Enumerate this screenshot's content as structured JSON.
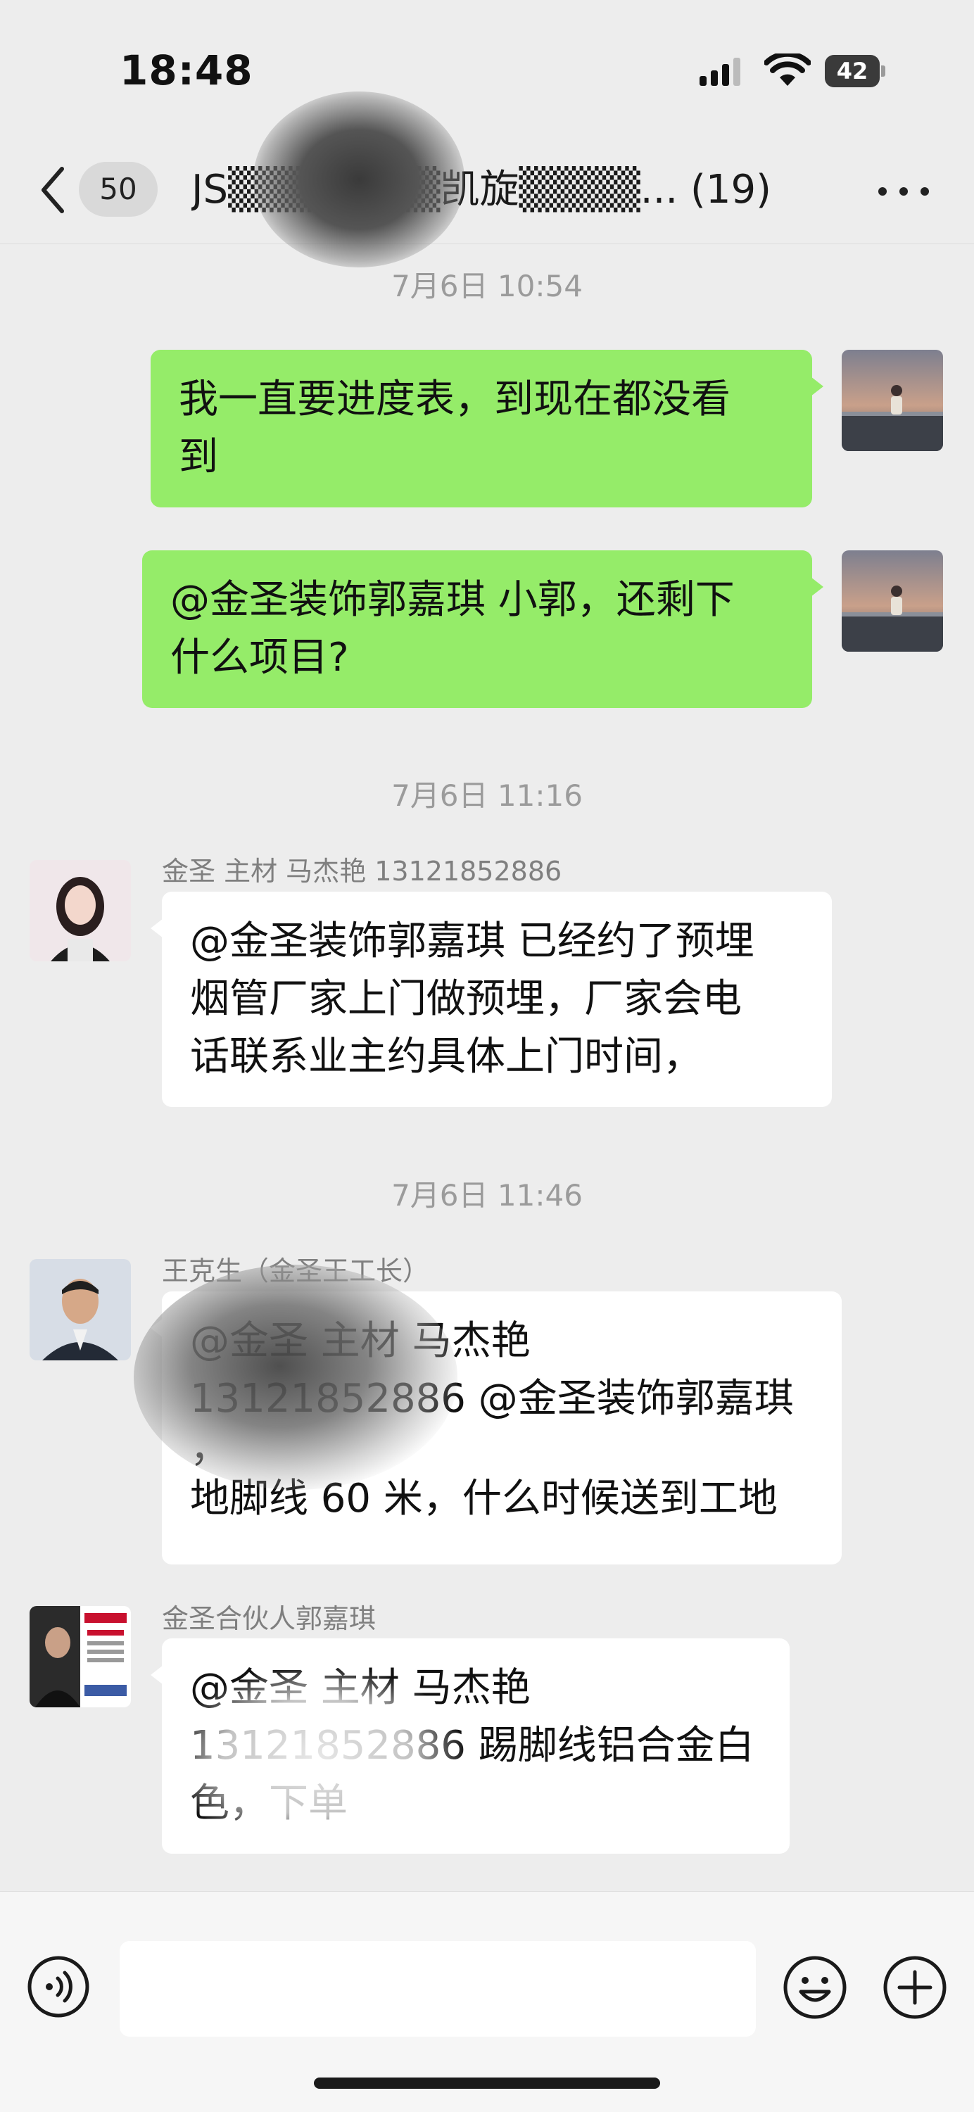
{
  "status_bar": {
    "time": "18:48",
    "battery_level": "42"
  },
  "header": {
    "unread_count": "50",
    "title": "JS▒▒▒▒▒▒▒凯旋▒▒▒▒... (19)"
  },
  "messages": [
    {
      "type": "timestamp",
      "text": "7月6日 10:54"
    },
    {
      "type": "self",
      "lines": [
        "我一直要进度表，到现在都没看",
        "到"
      ]
    },
    {
      "type": "self",
      "lines": [
        "@金圣装饰郭嘉琪 小郭，还剩下",
        "什么项目?"
      ]
    },
    {
      "type": "timestamp",
      "text": "7月6日 11:16"
    },
    {
      "type": "other",
      "sender": "金圣 主材 马杰艳 13121852886",
      "lines": [
        "@金圣装饰郭嘉琪 已经约了预埋",
        "烟管厂家上门做预埋，厂家会电",
        "话联系业主约具体上门时间，"
      ]
    },
    {
      "type": "timestamp",
      "text": "7月6日 11:46"
    },
    {
      "type": "other",
      "sender": "王克生（金圣王工长）",
      "lines": [
        "@金圣 主材 马杰艳",
        "13121852886 @金圣装饰郭嘉琪",
        "，",
        "地脚线 60 米，什么时候送到工地"
      ]
    },
    {
      "type": "other",
      "sender": "金圣合伙人郭嘉琪",
      "lines": [
        "@金圣 主材 马杰艳",
        "13121852886 踢脚线铝合金白",
        "色，下单"
      ]
    }
  ],
  "input": {
    "placeholder": ""
  },
  "colors": {
    "self_bubble": "#95ec69",
    "other_bubble": "#ffffff",
    "background": "#ededed",
    "timestamp": "#9b9b9b"
  },
  "icons": [
    "back-icon",
    "more-icon",
    "voice-icon",
    "emoji-icon",
    "plus-icon",
    "signal-icon",
    "wifi-icon",
    "battery-icon"
  ]
}
